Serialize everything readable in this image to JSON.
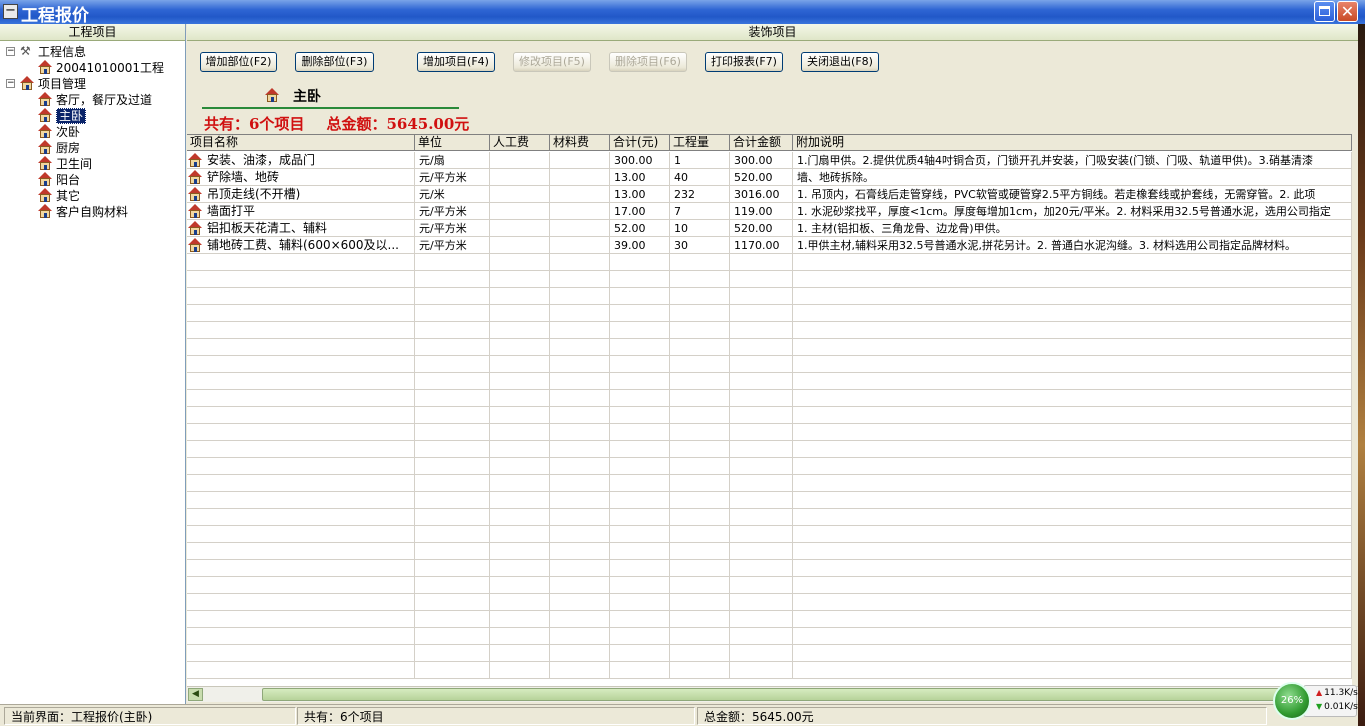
{
  "window": {
    "title": "工程报价",
    "sys_icon": "minus-icon",
    "max_icon": "maximize-icon",
    "close_icon": "close-icon"
  },
  "left_panel": {
    "header": "工程项目",
    "tree": [
      {
        "label": "工程信息",
        "level": 0,
        "icon": "tools-icon",
        "expanded": true
      },
      {
        "label": "20041010001工程",
        "level": 1,
        "icon": "house-icon"
      },
      {
        "label": "项目管理",
        "level": 0,
        "icon": "house-icon",
        "expanded": true
      },
      {
        "label": "客厅，餐厅及过道",
        "level": 1,
        "icon": "house-icon"
      },
      {
        "label": "主卧",
        "level": 1,
        "icon": "house-icon",
        "selected": true
      },
      {
        "label": "次卧",
        "level": 1,
        "icon": "house-icon"
      },
      {
        "label": "厨房",
        "level": 1,
        "icon": "house-icon"
      },
      {
        "label": "卫生间",
        "level": 1,
        "icon": "house-icon"
      },
      {
        "label": "阳台",
        "level": 1,
        "icon": "house-icon"
      },
      {
        "label": "其它",
        "level": 1,
        "icon": "house-icon"
      },
      {
        "label": "客户自购材料",
        "level": 1,
        "icon": "house-icon"
      }
    ]
  },
  "right_panel": {
    "header": "装饰项目",
    "buttons": [
      {
        "label": "增加部位(F2)",
        "enabled": true
      },
      {
        "label": "删除部位(F3)",
        "enabled": true
      },
      {
        "label": "增加项目(F4)",
        "enabled": true
      },
      {
        "label": "修改项目(F5)",
        "enabled": false
      },
      {
        "label": "删除项目(F6)",
        "enabled": false
      },
      {
        "label": "打印报表(F7)",
        "enabled": true
      },
      {
        "label": "关闭退出(F8)",
        "enabled": true
      }
    ],
    "room_name": "主卧",
    "summary_count": "共有：6个项目",
    "summary_total": "总金额：5645.00元",
    "table": {
      "columns": [
        "项目名称",
        "单位",
        "人工费",
        "材料费",
        "合计(元)",
        "工程量",
        "合计金额",
        "附加说明"
      ],
      "rows": [
        [
          "安装、油漆，成品门",
          "元/扇",
          "",
          "",
          "300.00",
          "1",
          "300.00",
          "1.门扇甲供。2.提供优质4轴4吋铜合页，门锁开孔并安装，门吸安装(门锁、门吸、轨道甲供)。3.硝基清漆"
        ],
        [
          "铲除墙、地砖",
          "元/平方米",
          "",
          "",
          "13.00",
          "40",
          "520.00",
          "墙、地砖拆除。"
        ],
        [
          "吊顶走线(不开槽)",
          "元/米",
          "",
          "",
          "13.00",
          "232",
          "3016.00",
          "1. 吊顶内，石膏线后走管穿线，PVC软管或硬管穿2.5平方铜线。若走橡套线或护套线，无需穿管。2. 此项"
        ],
        [
          "墙面打平",
          "元/平方米",
          "",
          "",
          "17.00",
          "7",
          "119.00",
          "1. 水泥砂浆找平，厚度<1cm。厚度每增加1cm，加20元/平米。2. 材料采用32.5号普通水泥，选用公司指定"
        ],
        [
          "铝扣板天花清工、辅料",
          "元/平方米",
          "",
          "",
          "52.00",
          "10",
          "520.00",
          "1. 主材(铝扣板、三角龙骨、边龙骨)甲供。"
        ],
        [
          "铺地砖工费、辅料(600×600及以...",
          "元/平方米",
          "",
          "",
          "39.00",
          "30",
          "1170.00",
          "1.甲供主材,辅料采用32.5号普通水泥,拼花另计。2. 普通白水泥沟缝。3. 材料选用公司指定品牌材料。"
        ]
      ]
    }
  },
  "status_bar": {
    "current": "当前界面：工程报价(主卧)",
    "count": "共有：6个项目",
    "total": "总金额：5645.00元"
  },
  "net_widget": {
    "percent": "26%",
    "up": "11.3K/s",
    "down": "0.01K/s"
  },
  "colors": {
    "summary_red": "#d01010",
    "title_blue": "#2158c8",
    "selection": "#0a246a"
  }
}
